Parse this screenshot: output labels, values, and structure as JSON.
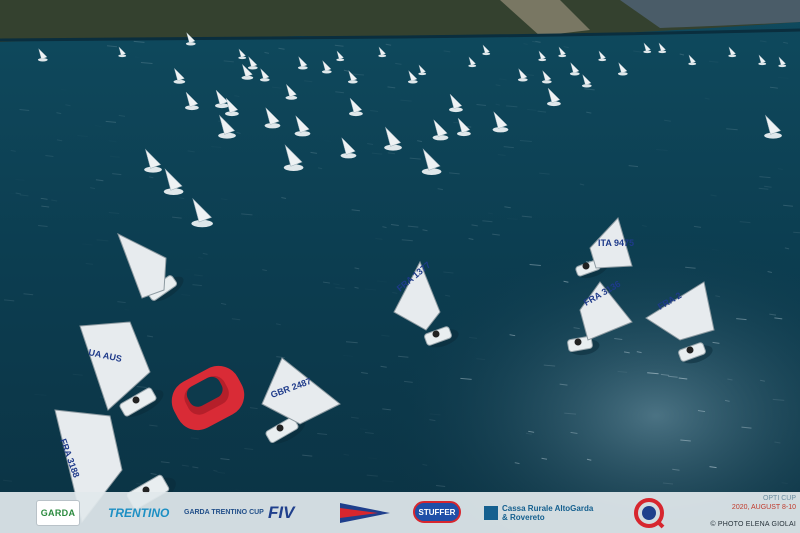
{
  "scene": {
    "description_colors": {
      "lake": "#0e3f52",
      "lake_dark": "#0a2e3e",
      "mountain": "#2e3b2a",
      "sail": "#e8ecef",
      "buoy": "#e8333c"
    },
    "sail_numbers": [
      {
        "id": "aus",
        "text": "UA AUS"
      },
      {
        "id": "fra-left",
        "text": "FRA 3188"
      },
      {
        "id": "gbr",
        "text": "GBR 2487"
      },
      {
        "id": "ita-mid",
        "text": "FRA 1377"
      },
      {
        "id": "ita-right",
        "text": "ITA 9475"
      },
      {
        "id": "fra-right",
        "text": "FRA 3136"
      },
      {
        "id": "fra-far",
        "text": "FRA 2"
      }
    ]
  },
  "sponsors": {
    "garda": "GARDA",
    "trentino": "TRENTINO",
    "cup": "GARDA TRENTINO CUP",
    "fiv": "FIV",
    "stuffer": "STUFFER",
    "cassa": "Cassa Rurale AltoGarda & Rovereto",
    "event_title": "OPTI CUP",
    "event_dates": "2020, AUGUST 8-10",
    "credit": "© PHOTO ELENA GIOLAI"
  }
}
